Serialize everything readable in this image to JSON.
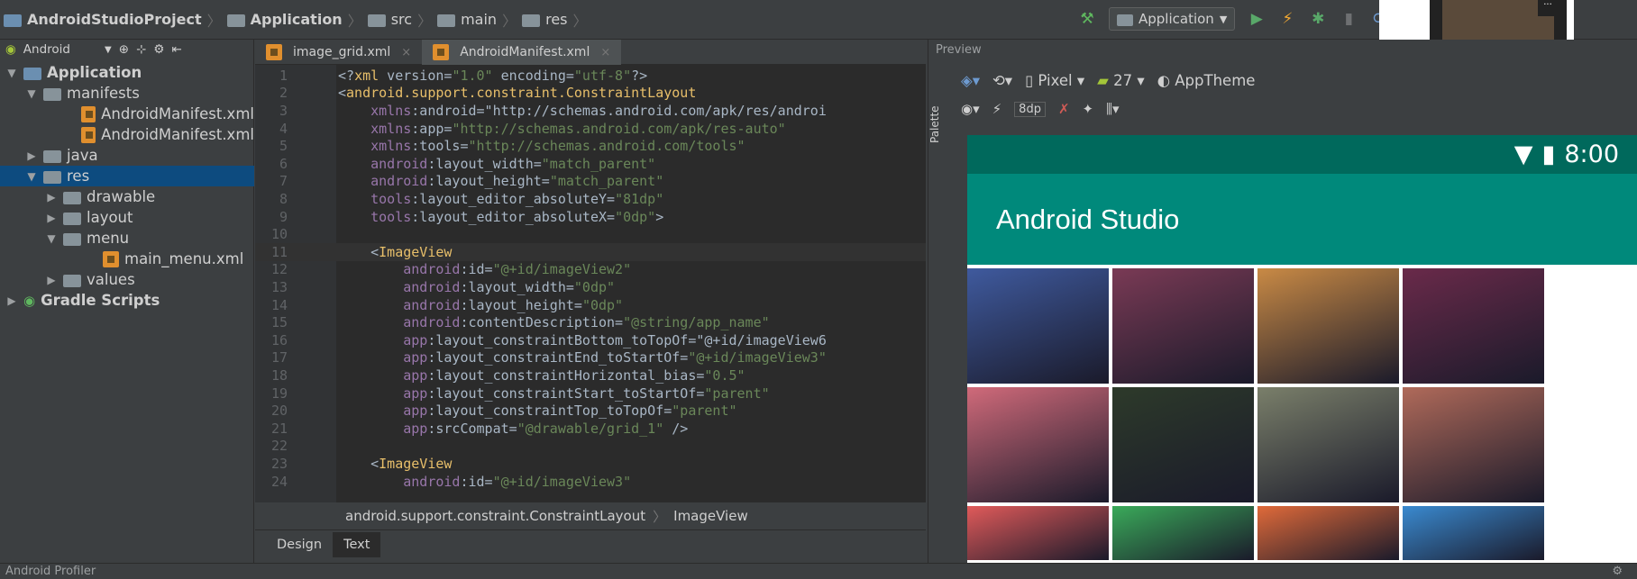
{
  "breadcrumb": {
    "project": "AndroidStudioProject",
    "module": "Application",
    "src": "src",
    "main": "main",
    "res": "res"
  },
  "run_config": "Application",
  "sidebar": {
    "view": "Android",
    "items": [
      {
        "label": "Application",
        "arrow": "▼",
        "indent": 0
      },
      {
        "label": "manifests",
        "arrow": "▼",
        "indent": 1
      },
      {
        "label": "AndroidManifest.xml",
        "arrow": "",
        "indent": 3
      },
      {
        "label": "AndroidManifest.xml",
        "arrow": "",
        "indent": 3
      },
      {
        "label": "java",
        "arrow": "▶",
        "indent": 1
      },
      {
        "label": "res",
        "arrow": "▼",
        "indent": 1
      },
      {
        "label": "drawable",
        "arrow": "▶",
        "indent": 2
      },
      {
        "label": "layout",
        "arrow": "▶",
        "indent": 2
      },
      {
        "label": "menu",
        "arrow": "▼",
        "indent": 2
      },
      {
        "label": "main_menu.xml",
        "arrow": "",
        "indent": 4
      },
      {
        "label": "values",
        "arrow": "▶",
        "indent": 2
      },
      {
        "label": "Gradle Scripts",
        "arrow": "▶",
        "indent": 0
      }
    ]
  },
  "editor_tabs": [
    "image_grid.xml",
    "AndroidManifest.xml"
  ],
  "code_lines": [
    {
      "n": "1",
      "t": "<?xml version=\"1.0\" encoding=\"utf-8\"?>"
    },
    {
      "n": "2",
      "t": "<android.support.constraint.ConstraintLayout"
    },
    {
      "n": "3",
      "t": "    xmlns:android=\"http://schemas.android.com/apk/res/androi"
    },
    {
      "n": "4",
      "t": "    xmlns:app=\"http://schemas.android.com/apk/res-auto\""
    },
    {
      "n": "5",
      "t": "    xmlns:tools=\"http://schemas.android.com/tools\""
    },
    {
      "n": "6",
      "t": "    android:layout_width=\"match_parent\""
    },
    {
      "n": "7",
      "t": "    android:layout_height=\"match_parent\""
    },
    {
      "n": "8",
      "t": "    tools:layout_editor_absoluteY=\"81dp\""
    },
    {
      "n": "9",
      "t": "    tools:layout_editor_absoluteX=\"0dp\">"
    },
    {
      "n": "10",
      "t": ""
    },
    {
      "n": "11",
      "t": "    <ImageView"
    },
    {
      "n": "12",
      "t": "        android:id=\"@+id/imageView2\""
    },
    {
      "n": "13",
      "t": "        android:layout_width=\"0dp\""
    },
    {
      "n": "14",
      "t": "        android:layout_height=\"0dp\""
    },
    {
      "n": "15",
      "t": "        android:contentDescription=\"@string/app_name\""
    },
    {
      "n": "16",
      "t": "        app:layout_constraintBottom_toTopOf=\"@+id/imageView6"
    },
    {
      "n": "17",
      "t": "        app:layout_constraintEnd_toStartOf=\"@+id/imageView3\""
    },
    {
      "n": "18",
      "t": "        app:layout_constraintHorizontal_bias=\"0.5\""
    },
    {
      "n": "19",
      "t": "        app:layout_constraintStart_toStartOf=\"parent\""
    },
    {
      "n": "20",
      "t": "        app:layout_constraintTop_toTopOf=\"parent\""
    },
    {
      "n": "21",
      "t": "        app:srcCompat=\"@drawable/grid_1\" />"
    },
    {
      "n": "22",
      "t": ""
    },
    {
      "n": "23",
      "t": "    <ImageView"
    },
    {
      "n": "24",
      "t": "        android:id=\"@+id/imageView3\""
    }
  ],
  "editor_breadcrumb": [
    "android.support.constraint.ConstraintLayout",
    "ImageView"
  ],
  "design_tabs": [
    "Design",
    "Text"
  ],
  "preview": {
    "title": "Preview",
    "palette": "Palette",
    "device": "Pixel",
    "api": "27",
    "theme": "AppTheme",
    "margin": "8dp",
    "time": "8:00",
    "app_title": "Android Studio"
  },
  "grid_colors": [
    [
      "#3f5a9e",
      "#7a3a55",
      "#c98a45",
      "#6a2a4a"
    ],
    [
      "#d06a7a",
      "#2d3a2a",
      "#7a7f6a",
      "#b06a5a"
    ],
    [
      "#e05a5a",
      "#3aaa5a",
      "#e06a3a",
      "#3a8ad0"
    ]
  ],
  "bottom_bar": "Android Profiler"
}
